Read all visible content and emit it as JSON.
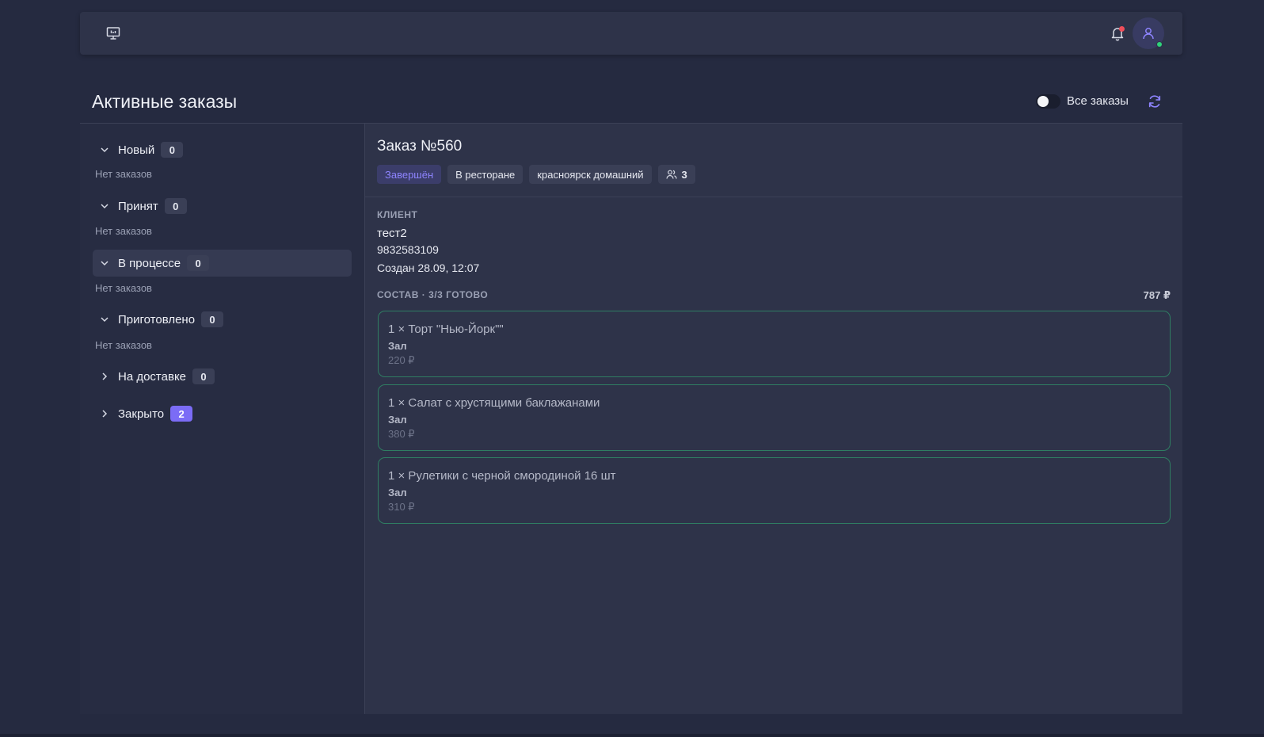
{
  "header": {
    "icons": {
      "monitor": "monitor-icon",
      "bell": "bell-icon",
      "user": "user-icon"
    },
    "notification_dot_color": "#f04e5a",
    "online_dot_color": "#2fd27a"
  },
  "page": {
    "title": "Активные заказы",
    "all_orders_toggle": {
      "label": "Все заказы",
      "on": false
    },
    "refresh_icon": "refresh-icon"
  },
  "statuses": [
    {
      "label": "Новый",
      "count": "0",
      "expanded": true,
      "empty_text": "Нет заказов"
    },
    {
      "label": "Принят",
      "count": "0",
      "expanded": true,
      "empty_text": "Нет заказов"
    },
    {
      "label": "В процессе",
      "count": "0",
      "expanded": true,
      "active": true,
      "empty_text": "Нет заказов"
    },
    {
      "label": "Приготовлено",
      "count": "0",
      "expanded": true,
      "empty_text": "Нет заказов"
    },
    {
      "label": "На доставке",
      "count": "0",
      "expanded": false
    },
    {
      "label": "Закрыто",
      "count": "2",
      "expanded": false
    }
  ],
  "order": {
    "title": "Заказ №560",
    "tags": {
      "status": "Завершён",
      "type": "В ресторане",
      "location": "красноярск домашний",
      "guests": "3"
    },
    "client": {
      "section_label": "КЛИЕНТ",
      "name": "тест2",
      "phone": "9832583109",
      "created": "Создан 28.09, 12:07"
    },
    "items_section": {
      "label": "СОСТАВ · 3/3 ГОТОВО",
      "total": "787 ₽"
    },
    "items": [
      {
        "name": "1 × Торт \"Нью-Йорк\"\"",
        "place": "Зал",
        "price": "220 ₽"
      },
      {
        "name": "1 × Салат с хрустящими баклажанами",
        "place": "Зал",
        "price": "380 ₽"
      },
      {
        "name": "1 × Рулетики с черной смородиной 16 шт",
        "place": "Зал",
        "price": "310 ₽"
      }
    ]
  },
  "colors": {
    "accent": "#7b6cf6",
    "ready_border": "#2f7d62",
    "background": "#252a40"
  }
}
